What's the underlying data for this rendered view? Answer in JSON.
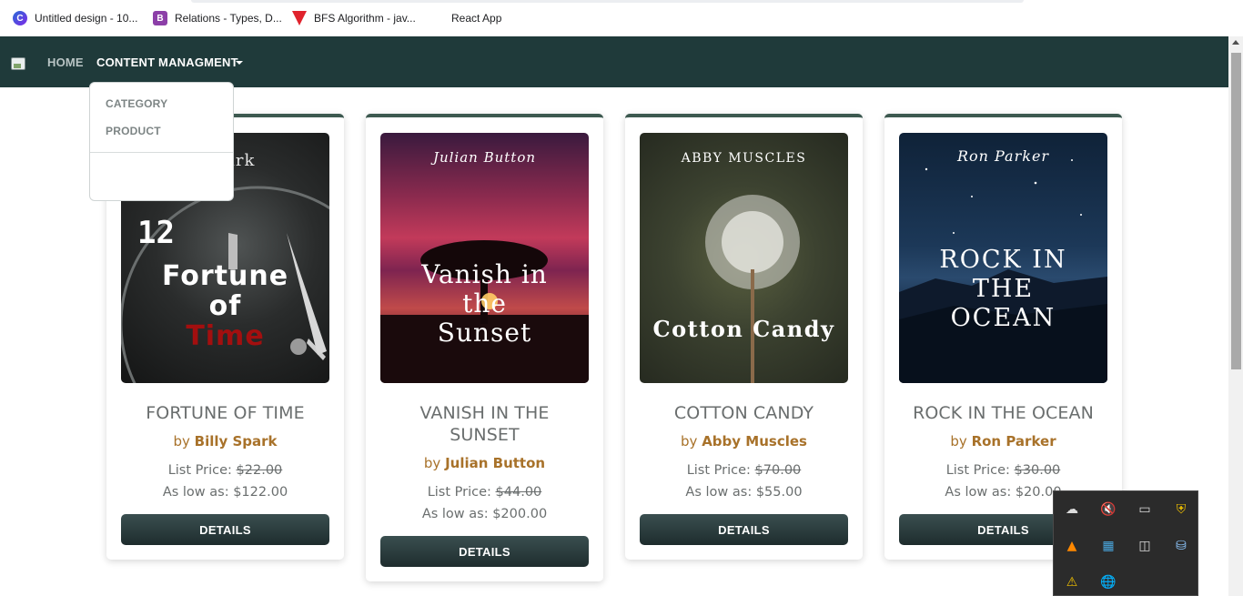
{
  "bookmarks": [
    {
      "label": "Untitled design - 10...",
      "icon": "canva-icon",
      "glyph": "C"
    },
    {
      "label": "Relations - Types, D...",
      "icon": "relations-icon",
      "glyph": "B"
    },
    {
      "label": "BFS Algorithm - jav...",
      "icon": "bfs-icon",
      "glyph": ""
    },
    {
      "label": "React App",
      "icon": "react-icon",
      "glyph": "⚛"
    }
  ],
  "nav": {
    "home": "HOME",
    "content_management": "CONTENT MANAGMENT"
  },
  "dropdown": {
    "items": [
      "CATEGORY",
      "PRODUCT"
    ]
  },
  "books": [
    {
      "cover_author": "Billy Spark",
      "cover_author_fragment": "park",
      "cover_title_lines": [
        "Fortune",
        "of",
        "Time"
      ],
      "title": "FORTUNE OF TIME",
      "title_lines": [
        "FORTUNE OF TIME"
      ],
      "by": "by",
      "author": "Billy Spark",
      "list_price_label": "List Price:",
      "list_price": "$22.00",
      "low_label": "As low as:",
      "low_price": "$122.00",
      "button": "DETAILS"
    },
    {
      "cover_author": "Julian Button",
      "cover_title_lines": [
        "Vanish in",
        "the",
        "Sunset"
      ],
      "title": "VANISH IN THE SUNSET",
      "title_lines": [
        "VANISH IN THE",
        "SUNSET"
      ],
      "by": "by",
      "author": "Julian Button",
      "list_price_label": "List Price:",
      "list_price": "$44.00",
      "low_label": "As low as:",
      "low_price": "$200.00",
      "button": "DETAILS"
    },
    {
      "cover_author": "ABBY MUSCLES",
      "cover_title_lines": [
        "Cotton Candy"
      ],
      "title": "COTTON CANDY",
      "title_lines": [
        "COTTON CANDY"
      ],
      "by": "by",
      "author": "Abby Muscles",
      "list_price_label": "List Price:",
      "list_price": "$70.00",
      "low_label": "As low as:",
      "low_price": "$55.00",
      "button": "DETAILS"
    },
    {
      "cover_author": "Ron Parker",
      "cover_title_lines": [
        "ROCK IN",
        "THE",
        "OCEAN"
      ],
      "title": "ROCK IN THE OCEAN",
      "title_lines": [
        "ROCK IN THE OCEAN"
      ],
      "by": "by",
      "author": "Ron Parker",
      "list_price_label": "List Price:",
      "list_price": "$30.00",
      "low_label": "As low as:",
      "low_price": "$20.00",
      "button": "DETAILS"
    }
  ],
  "tray": {
    "icons": [
      "onedrive-icon",
      "volume-muted-icon",
      "display-icon",
      "shield-warning-icon",
      "vlc-icon",
      "app-grid-icon",
      "camera-icon",
      "drive-icon",
      "device-warning-icon",
      "globe-icon"
    ]
  },
  "colors": {
    "navbar": "#1f3a3a",
    "author": "#a8722a",
    "button": "#2b3b3c",
    "card_top": "#3d5950"
  }
}
